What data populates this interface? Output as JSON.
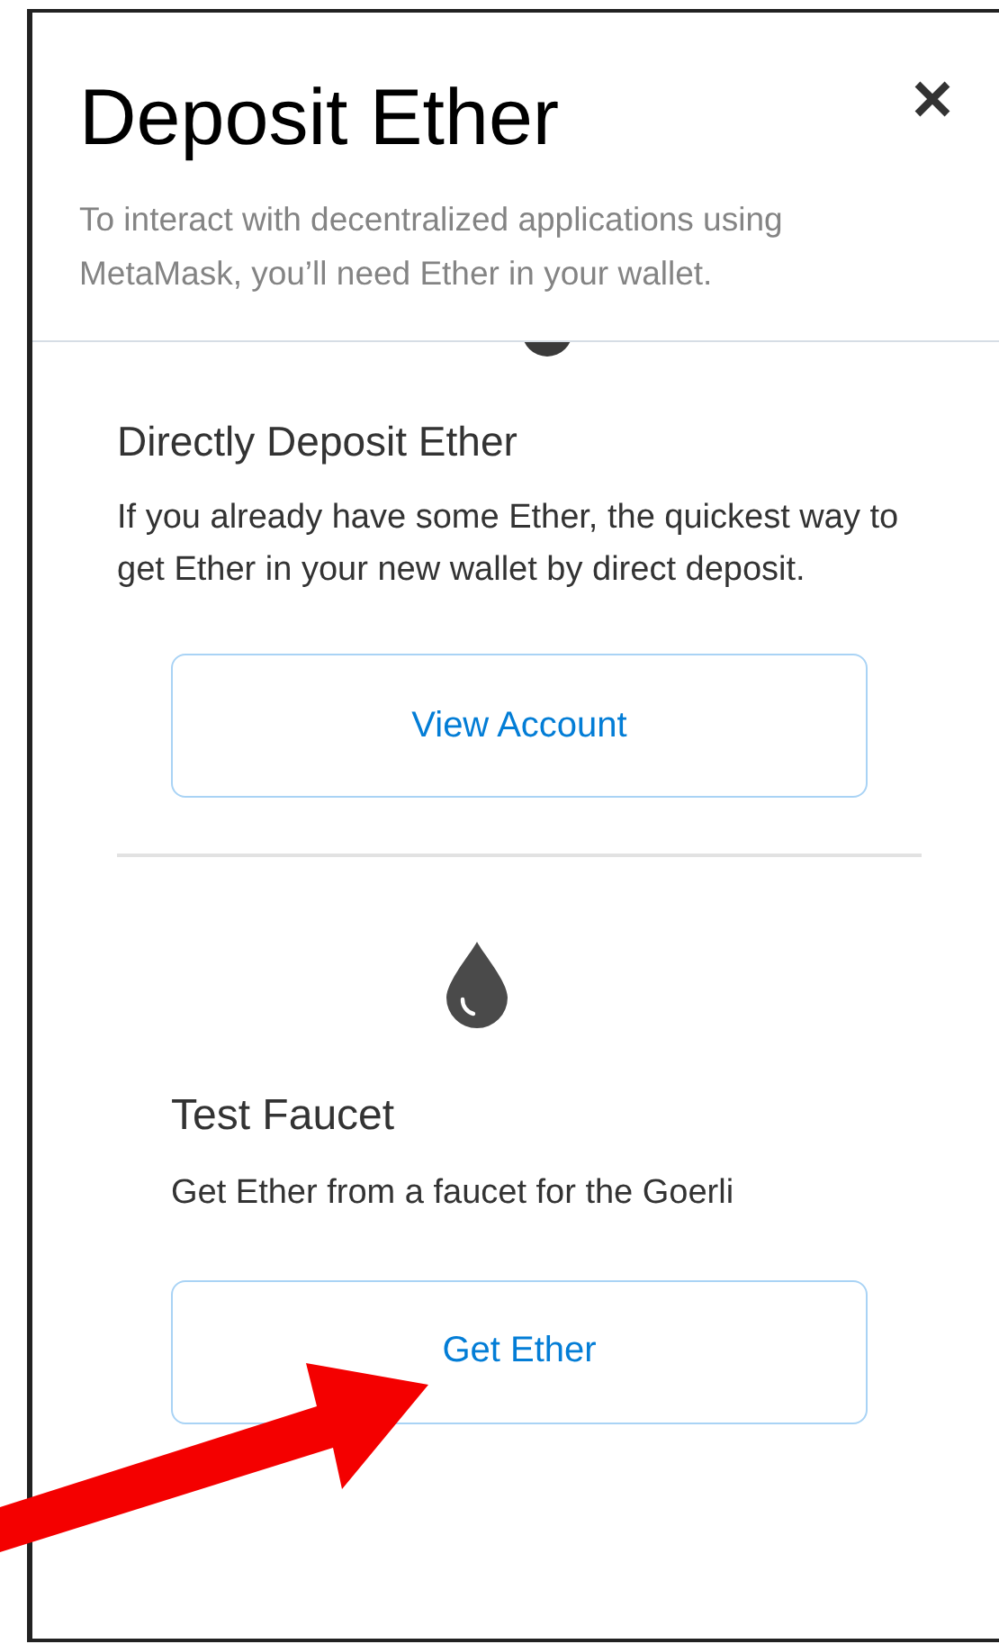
{
  "dialog": {
    "title": "Deposit Ether",
    "subtitle": "To interact with decentralized applications using MetaMask, you’ll need Ether in your wallet."
  },
  "sections": [
    {
      "kind": "direct",
      "heading": "Directly Deposit Ether",
      "description": "If you already have some Ether, the quickest way to get Ether in your new wallet by direct deposit.",
      "button": "View Account"
    },
    {
      "kind": "faucet",
      "heading": "Test Faucet",
      "description": "Get Ether from a faucet for the Goerli",
      "button": "Get Ether"
    }
  ]
}
